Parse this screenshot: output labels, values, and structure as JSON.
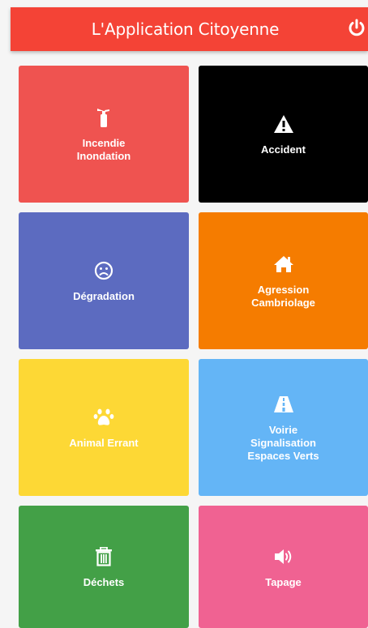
{
  "header": {
    "title": "L'Application Citoyenne",
    "color": "#f44336",
    "power_icon": "power-icon"
  },
  "tiles": [
    {
      "label": "Incendie\nInondation",
      "color": "#ef5350",
      "icon": "fire-extinguisher-icon"
    },
    {
      "label": "Accident",
      "color": "#000000",
      "icon": "warning-icon"
    },
    {
      "label": "Dégradation",
      "color": "#5c6bc0",
      "icon": "sad-face-icon"
    },
    {
      "label": "Agression\nCambriolage",
      "color": "#f57c00",
      "icon": "home-icon"
    },
    {
      "label": "Animal Errant",
      "color": "#fdd835",
      "icon": "paw-icon"
    },
    {
      "label": "Voirie\nSignalisation\nEspaces Verts",
      "color": "#64b5f6",
      "icon": "road-icon"
    },
    {
      "label": "Déchets",
      "color": "#43a047",
      "icon": "trash-icon"
    },
    {
      "label": "Tapage",
      "color": "#f06292",
      "icon": "volume-icon"
    }
  ]
}
